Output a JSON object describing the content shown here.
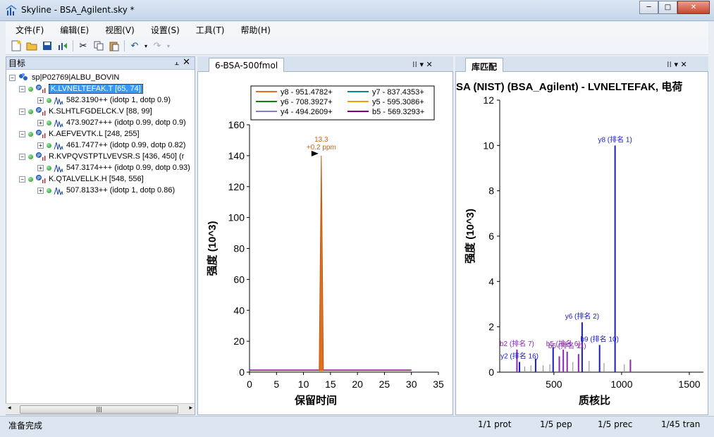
{
  "window": {
    "title": "Skyline - BSA_Agilent.sky *",
    "min": "─",
    "max": "□",
    "close": "✕"
  },
  "menu": [
    "文件(F)",
    "编辑(E)",
    "视图(V)",
    "设置(S)",
    "工具(T)",
    "帮助(H)"
  ],
  "targets_panel": {
    "title": "目标",
    "pin": "📌",
    "close": "✕",
    "root": "sp|P02769|ALBU_BOVIN",
    "peptides": [
      {
        "label": "K.LVNELTEFAK.T [65, 74]",
        "selected": true,
        "precursor": "582.3190++ (idotp 1, dotp 0.9)"
      },
      {
        "label": "K.SLHTLFGDELCK.V [88, 99]",
        "selected": false,
        "precursor": "473.9027+++ (idotp 0.99, dotp 0.9)"
      },
      {
        "label": "K.AEFVEVTK.L [248, 255]",
        "selected": false,
        "precursor": "461.7477++ (idotp 0.99, dotp 0.82)"
      },
      {
        "label": "R.KVPQVSTPTLVEVSR.S [436, 450] (r",
        "selected": false,
        "precursor": "547.3174+++ (idotp 0.99, dotp 0.93)"
      },
      {
        "label": "K.QTALVELLK.H [548, 556]",
        "selected": false,
        "precursor": "507.8133++ (idotp 1, dotp 0.86)"
      }
    ],
    "scroll_grip": "|||"
  },
  "chrom_panel": {
    "tab": "6-BSA-500fmol",
    "ctl": "⁞⁞ ▾ ✕",
    "ylabel": "强度 (10^3)",
    "xlabel": "保留时间",
    "peak_label": "13.3",
    "peak_sub": "+0.2 ppm",
    "legend": [
      {
        "name": "y8 - 951.4782+",
        "color": "#e07020"
      },
      {
        "name": "y7 - 837.4353+",
        "color": "#108888"
      },
      {
        "name": "y6 - 708.3927+",
        "color": "#108010"
      },
      {
        "name": "y5 - 595.3086+",
        "color": "#f0a000"
      },
      {
        "name": "y4 - 494.2609+",
        "color": "#8080c0"
      },
      {
        "name": "b5 - 569.3293+",
        "color": "#800080"
      }
    ]
  },
  "lib_panel": {
    "tab": "库匹配",
    "ctl": "⁞⁞ ▾ ✕",
    "title": "SA (NIST) (BSA_Agilent) - LVNELTEFAK, 电荷",
    "ylabel": "强度 (10^3)",
    "xlabel": "质核比"
  },
  "chart_data": [
    {
      "type": "line",
      "title": "",
      "xlabel": "保留时间",
      "ylabel": "强度 (10^3)",
      "xlim": [
        0,
        35
      ],
      "ylim": [
        0,
        160
      ],
      "xticks": [
        "0",
        "5",
        "10",
        "15",
        "20",
        "25",
        "30",
        "35"
      ],
      "yticks": [
        "0",
        "20",
        "40",
        "60",
        "80",
        "100",
        "120",
        "140",
        "160"
      ],
      "series": [
        {
          "name": "y8 - 951.4782+",
          "peak_x": 13.3,
          "peak_y": 140,
          "baseline": 1
        }
      ],
      "annotations": [
        "13.3",
        "+0.2 ppm"
      ]
    },
    {
      "type": "bar",
      "title": "SA (NIST) (BSA_Agilent) - LVNELTEFAK, 电荷",
      "xlabel": "质核比",
      "ylabel": "强度 (10^3)",
      "xlim": [
        100,
        1500
      ],
      "ylim": [
        0,
        12
      ],
      "xticks": [
        "500",
        "1000",
        "1500"
      ],
      "yticks": [
        "0",
        "2",
        "4",
        "6",
        "8",
        "10",
        "12"
      ],
      "peaks": [
        {
          "mz": 951.5,
          "y": 10.0,
          "label": "y8 (排名 1)",
          "color": "#1a1acc"
        },
        {
          "mz": 708.4,
          "y": 2.2,
          "label": "y6 (排名 2)",
          "color": "#1a1acc"
        },
        {
          "mz": 569.3,
          "y": 1.0,
          "label": "b5 (排名 6)",
          "color": "#8a2ab0"
        },
        {
          "mz": 598,
          "y": 0.9,
          "label": "b6 (排名 11)",
          "color": "#8a2ab0"
        },
        {
          "mz": 227.2,
          "y": 1.0,
          "label": "b2 (排名 7)",
          "color": "#8a2ab0"
        },
        {
          "mz": 246,
          "y": 0.45,
          "label": "y2 (排名 16)",
          "color": "#1a1acc"
        },
        {
          "mz": 837.4,
          "y": 1.2,
          "label": "b9 (排名 10)",
          "color": "#1a1acc"
        },
        {
          "mz": 494.3,
          "y": 1.1,
          "label": "",
          "color": "#1a1acc"
        },
        {
          "mz": 1065,
          "y": 0.55,
          "label": "",
          "color": "#8a2ab0"
        },
        {
          "mz": 365,
          "y": 0.6,
          "label": "",
          "color": "#1a1acc"
        },
        {
          "mz": 682,
          "y": 0.8,
          "label": "",
          "color": "#8a2ab0"
        },
        {
          "mz": 870,
          "y": 0.4,
          "label": "",
          "color": "#888888"
        },
        {
          "mz": 330,
          "y": 0.3,
          "label": "",
          "color": "#888888"
        },
        {
          "mz": 470,
          "y": 0.35,
          "label": "",
          "color": "#888888"
        },
        {
          "mz": 540,
          "y": 0.7,
          "label": "",
          "color": "#8a2ab0"
        },
        {
          "mz": 640,
          "y": 0.45,
          "label": "",
          "color": "#888888"
        },
        {
          "mz": 760,
          "y": 0.5,
          "label": "",
          "color": "#888888"
        },
        {
          "mz": 1020,
          "y": 0.35,
          "label": "",
          "color": "#888888"
        },
        {
          "mz": 285,
          "y": 0.25,
          "label": "",
          "color": "#888888"
        },
        {
          "mz": 420,
          "y": 0.3,
          "label": "",
          "color": "#888888"
        }
      ]
    }
  ],
  "status": {
    "ready": "准备完成",
    "prot": "1/1 prot",
    "pep": "1/5 pep",
    "prec": "1/5 prec",
    "tran": "1/45 tran"
  }
}
